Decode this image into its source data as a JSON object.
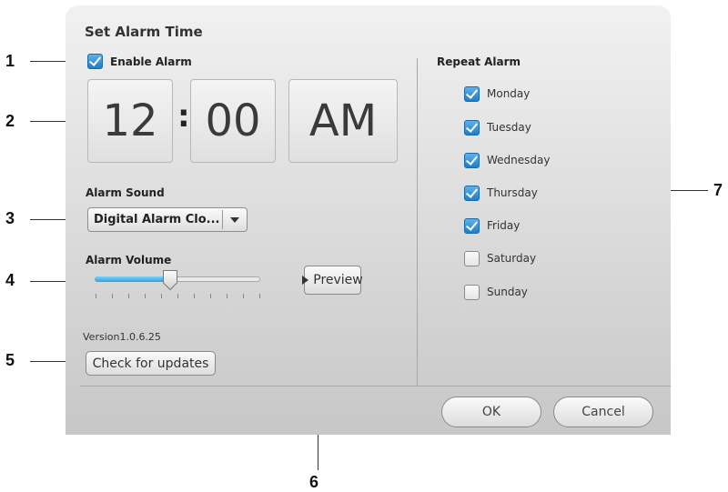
{
  "dialog": {
    "title": "Set Alarm Time",
    "enable_alarm_label": "Enable Alarm",
    "enable_alarm_checked": true,
    "time": {
      "hour": "12",
      "minute": "00",
      "ampm": "AM",
      "separator": ":"
    },
    "alarm_sound_label": "Alarm Sound",
    "alarm_sound_value": "Digital Alarm Clo...",
    "alarm_volume_label": "Alarm Volume",
    "alarm_volume_level": 0.46,
    "preview_label": "Preview",
    "version_text": "Version1.0.6.25",
    "check_updates_label": "Check for updates",
    "repeat_alarm_label": "Repeat Alarm",
    "days": [
      {
        "label": "Monday",
        "checked": true
      },
      {
        "label": "Tuesday",
        "checked": true
      },
      {
        "label": "Wednesday",
        "checked": true
      },
      {
        "label": "Thursday",
        "checked": true
      },
      {
        "label": "Friday",
        "checked": true
      },
      {
        "label": "Saturday",
        "checked": false
      },
      {
        "label": "Sunday",
        "checked": false
      }
    ],
    "ok_label": "OK",
    "cancel_label": "Cancel",
    "accent_color": "#2a8fd6"
  },
  "callouts": [
    "1",
    "2",
    "3",
    "4",
    "5",
    "6",
    "7"
  ]
}
